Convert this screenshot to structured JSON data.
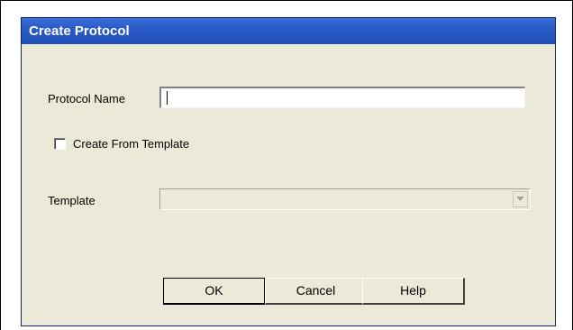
{
  "dialog": {
    "title": "Create Protocol"
  },
  "form": {
    "protocol_name_label": "Protocol Name",
    "protocol_name_value": "",
    "create_from_template_label": "Create From Template",
    "create_from_template_checked": false,
    "template_label": "Template",
    "template_value": ""
  },
  "buttons": {
    "ok_label": "OK",
    "cancel_label": "Cancel",
    "help_label": "Help"
  }
}
